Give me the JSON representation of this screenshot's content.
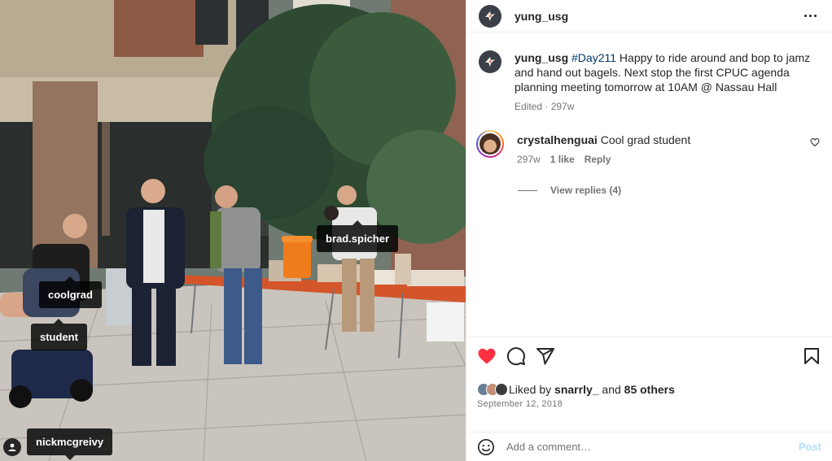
{
  "post": {
    "username": "yung_usg",
    "caption_hashtag": "#Day211",
    "caption_text": "Happy to ride around and bop to jamz and hand out bagels. Next stop the first CPUC agenda planning meeting tomorrow at 10AM @ Nassau Hall",
    "caption_meta": "Edited · 297w"
  },
  "photo_tags": [
    "coolgrad",
    "student",
    "brad.spicher",
    "nickmcgreivy"
  ],
  "comments": [
    {
      "username": "crystalhenguai",
      "text": "Cool grad student",
      "age": "297w",
      "likes": "1 like",
      "reply_label": "Reply",
      "view_replies": "View replies (4)"
    }
  ],
  "actions": {
    "liked_prefix": "Liked by",
    "liked_user": "snarrly_",
    "liked_and": "and",
    "liked_others": "85 others",
    "date": "September 12, 2018"
  },
  "composer": {
    "placeholder": "Add a comment…",
    "post_label": "Post"
  },
  "colors": {
    "like_red": "#ff3040",
    "link_blue": "#00376b",
    "post_disabled": "#b2dffc",
    "meta_gray": "#737373"
  },
  "icons": [
    "more-icon",
    "heart-icon",
    "comment-icon",
    "share-icon",
    "bookmark-icon",
    "emoji-icon",
    "user-tag-icon"
  ]
}
